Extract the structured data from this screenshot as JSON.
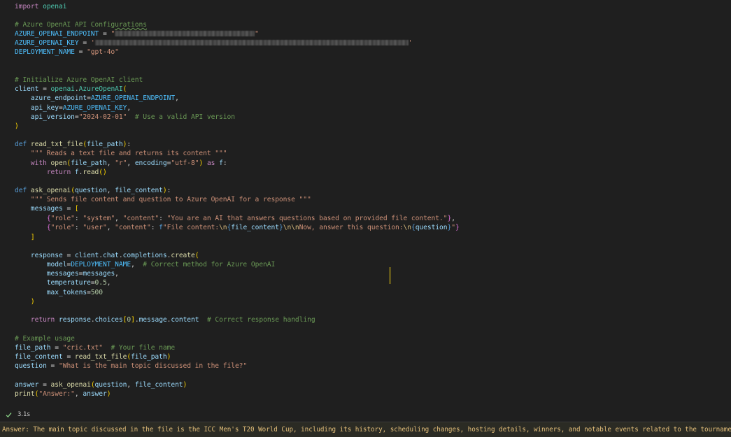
{
  "editor": {
    "lines": {
      "l1": "import openai",
      "l3": "# Azure OpenAI API Configurations",
      "l4_name": "AZURE_OPENAI_ENDPOINT",
      "l5_name": "AZURE_OPENAI_KEY",
      "l6_name": "DEPLOYMENT_NAME",
      "l6_value": "\"gpt-4o\"",
      "l9": "# Initialize Azure OpenAI client",
      "l10_var": "client",
      "l10_call": "AzureOpenAI",
      "l11_arg": "azure_endpoint",
      "l11_val": "AZURE_OPENAI_ENDPOINT",
      "l12_arg": "api_key",
      "l12_val": "AZURE_OPENAI_KEY",
      "l13_arg": "api_version",
      "l13_val": "\"2024-02-01\"",
      "l13_cmt": "# Use a valid API version",
      "l16_fn": "read_txt_file",
      "l16_param": "file_path",
      "l17": "\"\"\" Reads a text file and returns its content \"\"\"",
      "l18_a": "file_path",
      "l18_b": "\"r\"",
      "l18_c": "encoding",
      "l18_d": "\"utf-8\"",
      "l18_e": "f",
      "l19_a": "f",
      "l19_b": "read",
      "l21_fn": "ask_openai",
      "l21_p1": "question",
      "l21_p2": "file_content",
      "l22": "\"\"\" Sends file content and question to Azure OpenAI for a response \"\"\"",
      "l23_var": "messages",
      "l24": "\"role\": \"system\", \"content\": \"You are an AI that answers questions based on provided file content.\"",
      "l25_a": "\"role\": \"user\", \"content\": f\"File content:",
      "l25_b": "file_content",
      "l25_c": "Now, answer this question:",
      "l25_d": "question",
      "l28_var": "response",
      "l28_call": "client.chat.completions.create",
      "l29_arg": "model",
      "l29_val": "DEPLOYMENT_NAME",
      "l29_cmt": "# Correct method for Azure OpenAI",
      "l30_arg": "messages",
      "l30_val": "messages",
      "l31_arg": "temperature",
      "l31_val": "0.5",
      "l32_arg": "max_tokens",
      "l32_val": "500",
      "l35_a": "response.choices",
      "l35_b": "0",
      "l35_c": ".message.content",
      "l35_cmt": "# Correct response handling",
      "l37": "# Example usage",
      "l38_var": "file_path",
      "l38_val": "\"cric.txt\"",
      "l38_cmt": "# Your file name",
      "l39_var": "file_content",
      "l39_fn": "read_txt_file",
      "l39_arg": "file_path",
      "l40_var": "question",
      "l40_val": "\"What is the main topic discussed in the file?\"",
      "l42_var": "answer",
      "l42_fn": "ask_openai",
      "l42_a1": "question",
      "l42_a2": "file_content",
      "l43_fn": "print",
      "l43_s": "\"Answer:\"",
      "l43_v": "answer"
    }
  },
  "cell_status": {
    "exec_time": "3.1s",
    "icon": "check-icon"
  },
  "output": {
    "text": "Answer: The main topic discussed in the file is the ICC Men's T20 World Cup, including its history, scheduling changes, hosting details, winners, and notable events related to the tournament."
  },
  "colors": {
    "background": "#1f1f1f",
    "keyword": "#569cd6",
    "string": "#ce9178",
    "comment": "#6a9955",
    "output_text": "#e5c07b",
    "success": "#89d185"
  }
}
